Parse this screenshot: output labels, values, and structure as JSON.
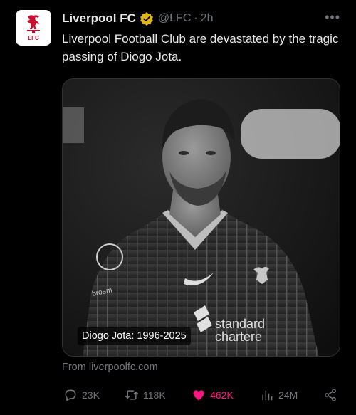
{
  "tweet": {
    "author": {
      "display_name": "Liverpool FC",
      "handle": "@LFC",
      "time": "2h",
      "verified": "gold-checkmark",
      "avatar_icon": "lfc-crest-icon",
      "avatar_text": "LFC"
    },
    "text": "Liverpool Football Club are devastated by the tragic passing of Diogo Jota.",
    "media": {
      "caption": "Diogo Jota: 1996-2025",
      "kit_text_sponsor": "standard chartered"
    },
    "source": "From liverpoolfc.com",
    "actions": {
      "replies": "23K",
      "retweets": "118K",
      "likes": "462K",
      "views": "24M"
    }
  },
  "colors": {
    "background": "#000000",
    "text": "#e7e9ea",
    "muted": "#71767b",
    "like": "#f91880",
    "verified": "#e2b719",
    "crest": "#c8102e"
  }
}
